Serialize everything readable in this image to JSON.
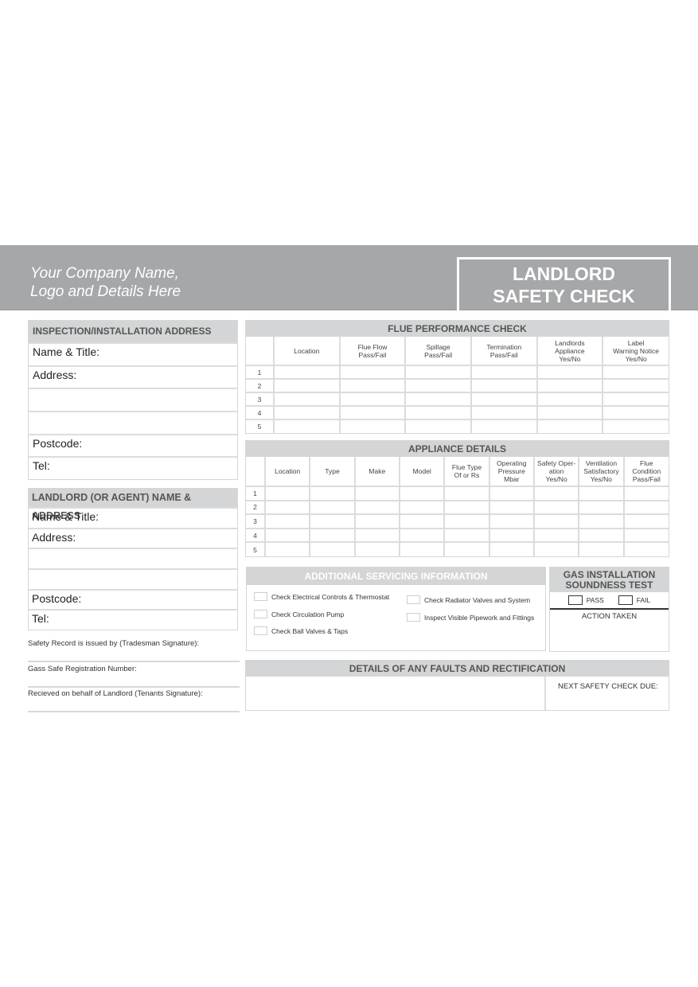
{
  "header": {
    "company_line1": "Your Company Name,",
    "company_line2": "Logo and Details Here",
    "title_line1": "LANDLORD",
    "title_line2": "SAFETY CHECK"
  },
  "inspection_address": {
    "heading": "INSPECTION/INSTALLATION ADDRESS",
    "rows": [
      "Name & Title:",
      "Address:",
      "",
      "",
      "Postcode:",
      "Tel:"
    ]
  },
  "landlord_address": {
    "heading": "LANDLORD (OR AGENT) NAME & ADDRESS",
    "rows": [
      "Name & Title:",
      "Address:",
      "",
      "",
      "Postcode:",
      "Tel:"
    ]
  },
  "signatures": [
    "Safety Record is issued by (Tradesman Signature):",
    "Gass Safe Registration Number:",
    "Recieved on behalf of Landlord (Tenants Signature):"
  ],
  "flue_check": {
    "heading": "FLUE PERFORMANCE CHECK",
    "columns": [
      "",
      "Location",
      "Flue Flow\nPass/Fail",
      "Spillage\nPass/Fail",
      "Termination\nPass/Fail",
      "Landlords\nAppliance\nYes/No",
      "Label\nWarning Notice\nYes/No"
    ],
    "rows": [
      "1",
      "2",
      "3",
      "4",
      "5"
    ]
  },
  "appliance_details": {
    "heading": "APPLIANCE DETAILS",
    "columns": [
      "",
      "Location",
      "Type",
      "Make",
      "Model",
      "Flue Type\nOf or Rs",
      "Operating\nPressure\nMbar",
      "Safety Oper-\nation\nYes/No",
      "Ventilation\nSatisfactory\nYes/No",
      "Flue\nCondition\nPass/Fail"
    ],
    "rows": [
      "1",
      "2",
      "3",
      "4",
      "5"
    ]
  },
  "additional_servicing": {
    "heading": "ADDITIONAL SERVICING INFORMATION",
    "items": [
      "Check Electrical Controls  & Thermostat",
      "Check Circulation Pump",
      "Check Ball Valves & Taps",
      "Check Radiator Valves and System",
      "Inspect Visible Pipework and Fittings"
    ]
  },
  "gas_soundness": {
    "heading_line1": "GAS INSTALLATION",
    "heading_line2": "SOUNDNESS TEST",
    "pass_label": "PASS",
    "fail_label": "FAIL",
    "action_label": "ACTION TAKEN"
  },
  "faults": {
    "heading": "DETAILS OF ANY FAULTS AND RECTIFICATION",
    "next_check_label": "NEXT SAFETY CHECK DUE:"
  }
}
